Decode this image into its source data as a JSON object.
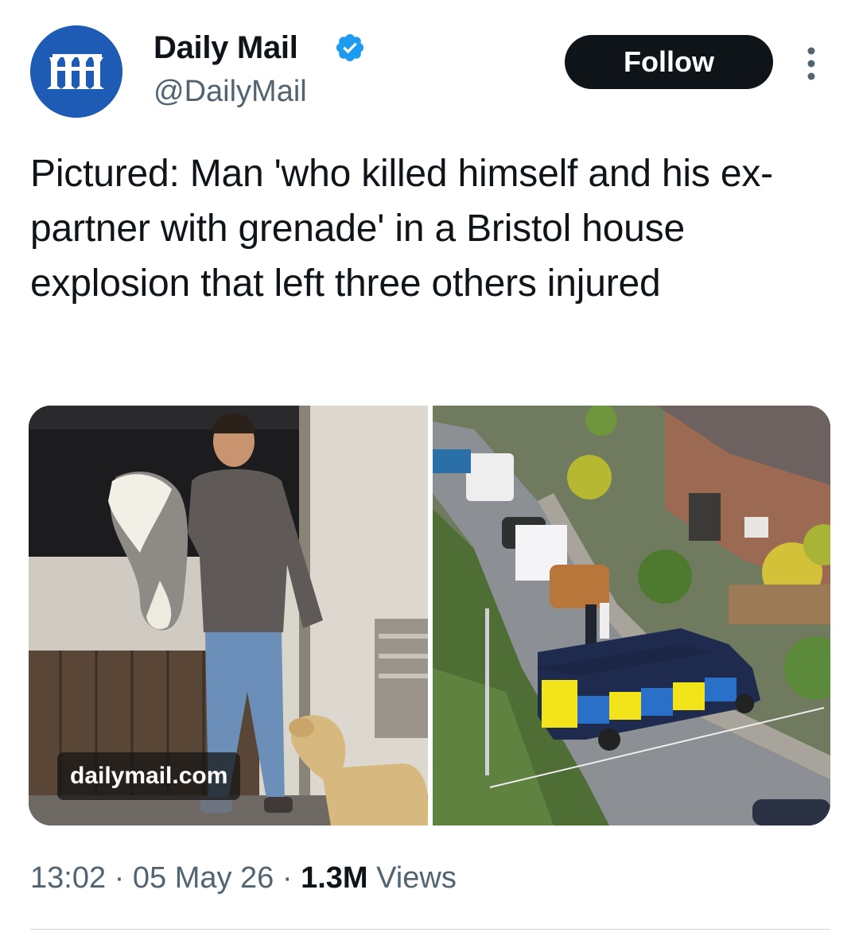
{
  "account": {
    "name": "Daily Mail",
    "handle": "@DailyMail",
    "avatar_icon": "daily-mail-logo",
    "verified_icon": "verified-badge-icon",
    "brand_color": "#1d5bb5"
  },
  "actions": {
    "follow_label": "Follow",
    "more_icon": "more-vertical-icon"
  },
  "tweet": {
    "text": "Pictured: Man 'who killed himself and his ex-partner with grenade' in a Bristol house explosion that left three others injured"
  },
  "media": {
    "watermark": "dailymail.com"
  },
  "meta": {
    "time": "13:02",
    "sep1": " · ",
    "date": "05 May 26",
    "sep2": " · ",
    "views_count": "1.3M",
    "views_label": " Views"
  },
  "colors": {
    "text": "#0f1419",
    "secondary_text": "#536471",
    "follow_bg": "#0f1419",
    "verified": "#1d9bf0"
  }
}
